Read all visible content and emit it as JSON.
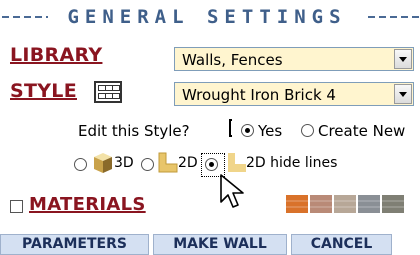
{
  "header": {
    "title": "GENERAL SETTINGS"
  },
  "library": {
    "label": "LIBRARY",
    "value": "Walls, Fences"
  },
  "style": {
    "label": "STYLE",
    "value": "Wrought Iron Brick 4"
  },
  "edit_style": {
    "question": "Edit this Style?",
    "yes_label": "Yes",
    "create_label": "Create New",
    "selected": "Yes"
  },
  "view_mode": {
    "opt_3d": "3D",
    "opt_2d": "2D",
    "opt_2d_hide": "2D hide lines",
    "selected": "2D hide lines"
  },
  "materials": {
    "label": "MATERIALS",
    "checked": false,
    "swatch_colors": [
      "#d9722a",
      "#b98a77",
      "#b7a797",
      "#8a8f95",
      "#7f7f74"
    ]
  },
  "buttons": {
    "parameters": "PARAMETERS",
    "make_wall": "MAKE WALL",
    "cancel": "CANCEL"
  }
}
